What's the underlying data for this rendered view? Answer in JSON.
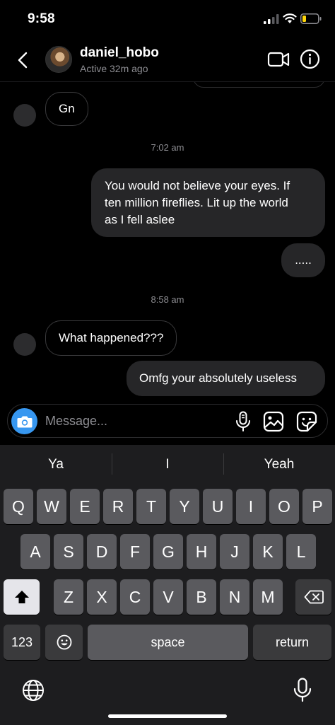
{
  "status_bar": {
    "time": "9:58"
  },
  "header": {
    "username": "daniel_hobo",
    "active_status": "Active 32m ago"
  },
  "chat": {
    "messages": [
      {
        "direction": "incoming",
        "text": "Gn"
      },
      {
        "type": "timestamp",
        "text": "7:02 am"
      },
      {
        "direction": "outgoing",
        "lines": [
          "You would not believe your eyes. If",
          "ten million fireflies. Lit up the world",
          "as I fell aslee"
        ]
      },
      {
        "direction": "outgoing",
        "text": "....."
      },
      {
        "type": "timestamp",
        "text": "8:58 am"
      },
      {
        "direction": "incoming",
        "text": "What happened???"
      },
      {
        "direction": "outgoing",
        "text": "Omfg your absolutely useless"
      }
    ]
  },
  "composer": {
    "placeholder": "Message..."
  },
  "keyboard": {
    "suggestions": [
      "Ya",
      "I",
      "Yeah"
    ],
    "row1": [
      "Q",
      "W",
      "E",
      "R",
      "T",
      "Y",
      "U",
      "I",
      "O",
      "P"
    ],
    "row2": [
      "A",
      "S",
      "D",
      "F",
      "G",
      "H",
      "J",
      "K",
      "L"
    ],
    "row3": [
      "Z",
      "X",
      "C",
      "V",
      "B",
      "N",
      "M"
    ],
    "numbers_label": "123",
    "space_label": "space",
    "return_label": "return"
  },
  "colors": {
    "accent": "#3797f0",
    "outgoing_bubble": "#262628",
    "keyboard_bg": "#1d1d1f"
  }
}
